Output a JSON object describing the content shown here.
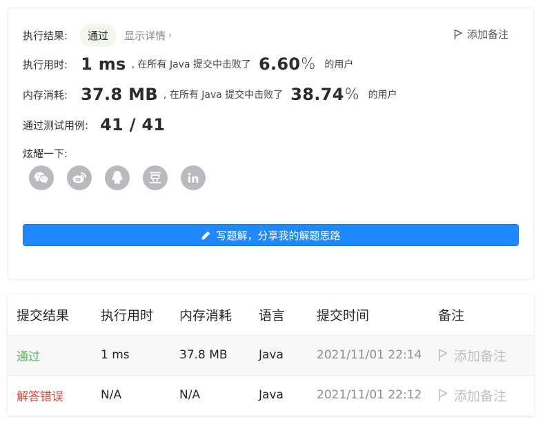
{
  "result": {
    "status_label": "执行结果:",
    "status": "通过",
    "detail_link": "显示详情",
    "add_note": "添加备注",
    "runtime_label": "执行用时:",
    "runtime_value": "1 ms",
    "runtime_mid": ", 在所有 Java 提交中击败了",
    "runtime_pct": "6.60",
    "memory_label": "内存消耗:",
    "memory_value": "37.8 MB",
    "memory_mid": ", 在所有 Java 提交中击败了",
    "memory_pct": "38.74",
    "pct_sign": "%",
    "suffix": "的用户",
    "tests_label": "通过测试用例:",
    "tests_value": "41 / 41",
    "share_label": "炫耀一下:",
    "share_icons": [
      "wechat-icon",
      "weibo-icon",
      "qq-icon",
      "douban-icon",
      "linkedin-icon"
    ],
    "write_solution": "写题解，分享我的解题思路"
  },
  "submissions": {
    "headers": [
      "提交结果",
      "执行用时",
      "内存消耗",
      "语言",
      "提交时间",
      "备注"
    ],
    "rows": [
      {
        "result": "通过",
        "runtime": "1 ms",
        "memory": "37.8 MB",
        "lang": "Java",
        "time": "2021/11/01 22:14",
        "note": "添加备注"
      },
      {
        "result": "解答错误",
        "runtime": "N/A",
        "memory": "N/A",
        "lang": "Java",
        "time": "2021/11/01 22:12",
        "note": "添加备注"
      }
    ]
  },
  "colors": {
    "accent": "#2189ff",
    "pass": "#5cb85c",
    "error": "#e0463c",
    "icon_grey": "#b8babd"
  }
}
